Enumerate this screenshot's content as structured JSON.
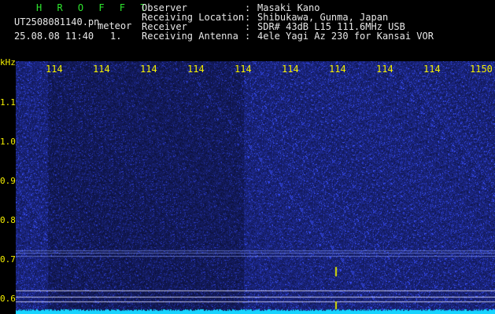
{
  "header": {
    "title": "H R O F F T",
    "filename": "UT2508081140.pn",
    "meteor_label": "meteor",
    "datetime": "25.08.08 11:40",
    "count": "1.",
    "fields": [
      {
        "label": "Observer",
        "value": "Masaki Kano"
      },
      {
        "label": "Receiving Location",
        "value": "Shibukawa, Gunma, Japan"
      },
      {
        "label": "Receiver",
        "value": "SDR# 43dB L15 111.6MHz USB"
      },
      {
        "label": "Receiving Antenna",
        "value": "4ele Yagi Az 230 for Kansai VOR"
      }
    ],
    "separator": ":"
  },
  "axis": {
    "unit": "kHz",
    "x_ticks": [
      "114",
      "114",
      "114",
      "114",
      "114",
      "114",
      "114",
      "114",
      "114",
      "1150"
    ],
    "y_ticks": [
      "1.1",
      "1.0",
      "0.9",
      "0.8",
      "0.7",
      "0.6"
    ]
  },
  "colors": {
    "background": "#000000",
    "spectrogram": "#0b1a6e",
    "noise": "#3a4fd8",
    "baseline": "#18d4ff",
    "ticks": "#f5f000",
    "title": "#2ee82e"
  }
}
